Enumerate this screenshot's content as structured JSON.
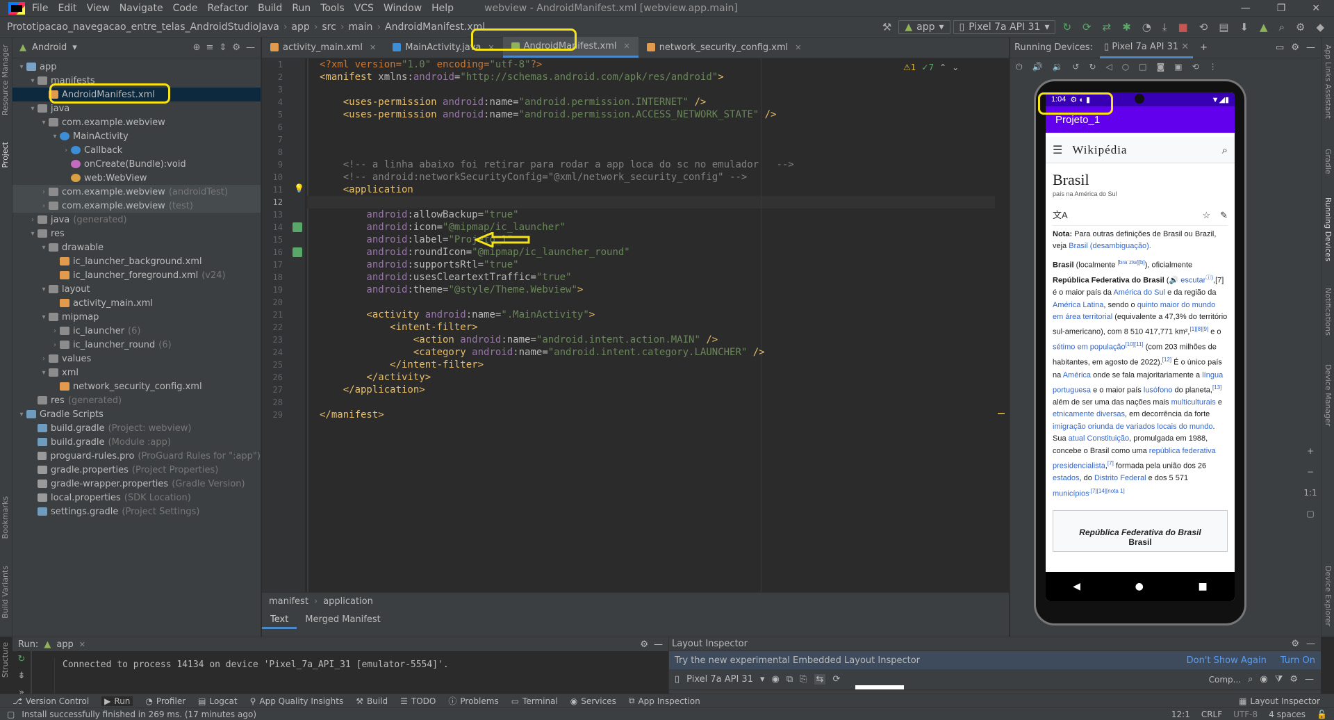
{
  "menu": {
    "items": [
      "File",
      "Edit",
      "View",
      "Navigate",
      "Code",
      "Refactor",
      "Build",
      "Run",
      "Tools",
      "VCS",
      "Window",
      "Help"
    ],
    "window_title": "webview - AndroidManifest.xml [webview.app.main]"
  },
  "nav": {
    "crumbs": [
      "Prototipacao_navegacao_entre_telas_AndroidStudioJava",
      "app",
      "src",
      "main",
      "AndroidManifest.xml"
    ],
    "run_config": "app",
    "device": "Pixel 7a API 31"
  },
  "project": {
    "view_label": "Android",
    "tree": [
      {
        "indent": 0,
        "arrow": "▾",
        "icon": "folderb",
        "label": "app",
        "dim": ""
      },
      {
        "indent": 1,
        "arrow": "▾",
        "icon": "folder",
        "label": "manifests",
        "dim": ""
      },
      {
        "indent": 2,
        "arrow": "",
        "icon": "xml",
        "label": "AndroidManifest.xml",
        "dim": "",
        "sel": true
      },
      {
        "indent": 1,
        "arrow": "▾",
        "icon": "folder",
        "label": "java",
        "dim": ""
      },
      {
        "indent": 2,
        "arrow": "▾",
        "icon": "folder",
        "label": "com.example.webview",
        "dim": ""
      },
      {
        "indent": 3,
        "arrow": "▾",
        "icon": "cls",
        "label": "MainActivity",
        "dim": ""
      },
      {
        "indent": 4,
        "arrow": "›",
        "icon": "cls",
        "label": "Callback",
        "dim": ""
      },
      {
        "indent": 4,
        "arrow": "",
        "icon": "meth",
        "label": "onCreate(Bundle):void",
        "dim": ""
      },
      {
        "indent": 4,
        "arrow": "",
        "icon": "fld",
        "label": "web:WebView",
        "dim": ""
      },
      {
        "indent": 2,
        "arrow": "›",
        "icon": "folder",
        "label": "com.example.webview",
        "dim": "(androidTest)",
        "gray": true
      },
      {
        "indent": 2,
        "arrow": "›",
        "icon": "folder",
        "label": "com.example.webview",
        "dim": "(test)",
        "gray": true
      },
      {
        "indent": 1,
        "arrow": "›",
        "icon": "folder",
        "label": "java",
        "dim": "(generated)"
      },
      {
        "indent": 1,
        "arrow": "▾",
        "icon": "folder",
        "label": "res",
        "dim": ""
      },
      {
        "indent": 2,
        "arrow": "▾",
        "icon": "folder",
        "label": "drawable",
        "dim": ""
      },
      {
        "indent": 3,
        "arrow": "",
        "icon": "xml",
        "label": "ic_launcher_background.xml",
        "dim": ""
      },
      {
        "indent": 3,
        "arrow": "",
        "icon": "xml",
        "label": "ic_launcher_foreground.xml",
        "dim": "(v24)"
      },
      {
        "indent": 2,
        "arrow": "▾",
        "icon": "folder",
        "label": "layout",
        "dim": ""
      },
      {
        "indent": 3,
        "arrow": "",
        "icon": "xml",
        "label": "activity_main.xml",
        "dim": ""
      },
      {
        "indent": 2,
        "arrow": "▾",
        "icon": "folder",
        "label": "mipmap",
        "dim": ""
      },
      {
        "indent": 3,
        "arrow": "›",
        "icon": "folder",
        "label": "ic_launcher",
        "dim": "(6)"
      },
      {
        "indent": 3,
        "arrow": "›",
        "icon": "folder",
        "label": "ic_launcher_round",
        "dim": "(6)"
      },
      {
        "indent": 2,
        "arrow": "›",
        "icon": "folder",
        "label": "values",
        "dim": ""
      },
      {
        "indent": 2,
        "arrow": "▾",
        "icon": "folder",
        "label": "xml",
        "dim": ""
      },
      {
        "indent": 3,
        "arrow": "",
        "icon": "xml",
        "label": "network_security_config.xml",
        "dim": ""
      },
      {
        "indent": 1,
        "arrow": "",
        "icon": "folder",
        "label": "res",
        "dim": "(generated)"
      },
      {
        "indent": 0,
        "arrow": "▾",
        "icon": "grad",
        "label": "Gradle Scripts",
        "dim": ""
      },
      {
        "indent": 1,
        "arrow": "",
        "icon": "grad",
        "label": "build.gradle",
        "dim": "(Project: webview)"
      },
      {
        "indent": 1,
        "arrow": "",
        "icon": "grad",
        "label": "build.gradle",
        "dim": "(Module :app)"
      },
      {
        "indent": 1,
        "arrow": "",
        "icon": "file",
        "label": "proguard-rules.pro",
        "dim": "(ProGuard Rules for \":app\")"
      },
      {
        "indent": 1,
        "arrow": "",
        "icon": "file",
        "label": "gradle.properties",
        "dim": "(Project Properties)"
      },
      {
        "indent": 1,
        "arrow": "",
        "icon": "file",
        "label": "gradle-wrapper.properties",
        "dim": "(Gradle Version)"
      },
      {
        "indent": 1,
        "arrow": "",
        "icon": "file",
        "label": "local.properties",
        "dim": "(SDK Location)"
      },
      {
        "indent": 1,
        "arrow": "",
        "icon": "grad",
        "label": "settings.gradle",
        "dim": "(Project Settings)"
      }
    ]
  },
  "left_strip": [
    "Resource Manager",
    "Project",
    "Bookmarks",
    "Build Variants",
    "Structure"
  ],
  "right_strip": [
    "App Links Assistant",
    "Gradle",
    "Running Devices",
    "Notifications",
    "Device Manager",
    "Device Explorer"
  ],
  "tabs": [
    {
      "label": "activity_main.xml",
      "color": "#e29a4c"
    },
    {
      "label": "MainActivity.java",
      "color": "#3d8ed6"
    },
    {
      "label": "AndroidManifest.xml",
      "color": "#8fb35a",
      "active": true
    },
    {
      "label": "network_security_config.xml",
      "color": "#e29a4c"
    }
  ],
  "inspections": {
    "warn": "⚠1",
    "ok": "✓7"
  },
  "code_lines": [
    [
      [
        "<?xml version=",
        "pl"
      ],
      [
        "\"1.0\"",
        "st"
      ],
      [
        " encoding=",
        "pl"
      ],
      [
        "\"utf-8\"",
        "st"
      ],
      [
        "?>",
        "pl"
      ]
    ],
    [
      [
        "<manifest ",
        "tg"
      ],
      [
        "xmlns:",
        "at"
      ],
      [
        "android",
        "ns"
      ],
      [
        "=",
        "at"
      ],
      [
        "\"http://schemas.android.com/apk/res/android\"",
        "st"
      ],
      [
        ">",
        "tg"
      ]
    ],
    [],
    [
      [
        "    <uses-permission ",
        "tg"
      ],
      [
        "android",
        "ns"
      ],
      [
        ":name=",
        "at"
      ],
      [
        "\"android.permission.INTERNET\"",
        "st"
      ],
      [
        " />",
        "tg"
      ]
    ],
    [
      [
        "    <uses-permission ",
        "tg"
      ],
      [
        "android",
        "ns"
      ],
      [
        ":name=",
        "at"
      ],
      [
        "\"android.permission.ACCESS_NETWORK_STATE\"",
        "st"
      ],
      [
        " />",
        "tg"
      ]
    ],
    [],
    [],
    [],
    [
      [
        "    <!-- a linha abaixo foi retirar para rodar a app loca do sc no emulador   -->",
        "cm"
      ]
    ],
    [
      [
        "    <!-- android:networkSecurityConfig=\"@xml/network_security_config\" -->",
        "cm"
      ]
    ],
    [
      [
        "    <application",
        "tg"
      ]
    ],
    [],
    [
      [
        "        android",
        "ns"
      ],
      [
        ":allowBackup=",
        "at"
      ],
      [
        "\"true\"",
        "st"
      ]
    ],
    [
      [
        "        android",
        "ns"
      ],
      [
        ":icon=",
        "at"
      ],
      [
        "\"@mipmap/ic_launcher\"",
        "st"
      ]
    ],
    [
      [
        "        android",
        "ns"
      ],
      [
        ":label=",
        "at"
      ],
      [
        "\"Projeto_1\"",
        "st"
      ]
    ],
    [
      [
        "        android",
        "ns"
      ],
      [
        ":roundIcon=",
        "at"
      ],
      [
        "\"@mipmap/ic_launcher_round\"",
        "st"
      ]
    ],
    [
      [
        "        android",
        "ns"
      ],
      [
        ":supportsRtl=",
        "at"
      ],
      [
        "\"true\"",
        "st"
      ]
    ],
    [
      [
        "        android",
        "ns"
      ],
      [
        ":usesCleartextTraffic=",
        "at"
      ],
      [
        "\"true\"",
        "st"
      ]
    ],
    [
      [
        "        android",
        "ns"
      ],
      [
        ":theme=",
        "at"
      ],
      [
        "\"@style/Theme.Webview\"",
        "st"
      ],
      [
        ">",
        "tg"
      ]
    ],
    [],
    [
      [
        "        <activity ",
        "tg"
      ],
      [
        "android",
        "ns"
      ],
      [
        ":name=",
        "at"
      ],
      [
        "\".MainActivity\"",
        "st"
      ],
      [
        ">",
        "tg"
      ]
    ],
    [
      [
        "            <intent-filter>",
        "tg"
      ]
    ],
    [
      [
        "                <action ",
        "tg"
      ],
      [
        "android",
        "ns"
      ],
      [
        ":name=",
        "at"
      ],
      [
        "\"android.intent.action.MAIN\"",
        "st"
      ],
      [
        " />",
        "tg"
      ]
    ],
    [
      [
        "                <category ",
        "tg"
      ],
      [
        "android",
        "ns"
      ],
      [
        ":name=",
        "at"
      ],
      [
        "\"android.intent.category.LAUNCHER\"",
        "st"
      ],
      [
        " />",
        "tg"
      ]
    ],
    [
      [
        "            </intent-filter>",
        "tg"
      ]
    ],
    [
      [
        "        </activity>",
        "tg"
      ]
    ],
    [
      [
        "    </application>",
        "tg"
      ]
    ],
    [],
    [
      [
        "</manifest>",
        "tg"
      ]
    ]
  ],
  "editor_footer": {
    "crumbs": [
      "manifest",
      "application"
    ],
    "tabs": [
      "Text",
      "Merged Manifest"
    ]
  },
  "devices": {
    "label": "Running Devices:",
    "device": "Pixel 7a API 31"
  },
  "phone": {
    "time": "1:04",
    "app_title": "Projeto_1",
    "wiki_logo": "Wikipédia",
    "article_title": "Brasil",
    "article_sub": "país na América do Sul",
    "note_bold": "Nota:",
    "note_text": "Para outras definições de Brasil ou Brazil, veja",
    "note_link": "Brasil (desambiguação).",
    "body": [
      [
        [
          "Brasil",
          "b"
        ],
        [
          " (localmente ",
          ""
        ],
        [
          "[bɾaˈziw]",
          "l"
        ],
        [
          "[b]",
          ""
        ],
        [
          "), oficialmente ",
          ""
        ],
        [
          "República Federativa do Brasil",
          "b"
        ],
        [
          " (🔊 ",
          ""
        ],
        [
          "escutar",
          "l"
        ],
        [
          "ⓘ)",
          ""
        ],
        [
          ",[7] é o maior país da ",
          ""
        ],
        [
          "América do Sul",
          "l"
        ],
        [
          " e da região da ",
          ""
        ],
        [
          "América Latina",
          "l"
        ],
        [
          ", sendo o ",
          ""
        ],
        [
          "quinto maior do mundo em área territorial",
          "l"
        ],
        [
          " (equivalente a 47,3% do território sul-americano), com 8 510 417,771 km²,",
          ""
        ],
        [
          "[1][8][9]",
          ""
        ],
        [
          " e o ",
          ""
        ],
        [
          "sétimo em população",
          "l"
        ],
        [
          "[10][11]",
          ""
        ],
        [
          " (com 203 milhões de habitantes, em agosto de 2022).",
          ""
        ],
        [
          "[12]",
          ""
        ],
        [
          " É o único país na ",
          ""
        ],
        [
          "América",
          "l"
        ],
        [
          " onde se fala majoritariamente a ",
          ""
        ],
        [
          "língua portuguesa",
          "l"
        ],
        [
          " e o maior país ",
          ""
        ],
        [
          "lusófono",
          "l"
        ],
        [
          " do planeta,",
          ""
        ],
        [
          "[13]",
          ""
        ],
        [
          " além de ser uma das nações mais ",
          ""
        ],
        [
          "multiculturais",
          "l"
        ],
        [
          " e ",
          ""
        ],
        [
          "etnicamente diversas",
          "l"
        ],
        [
          ", em decorrência da forte ",
          ""
        ],
        [
          "imigração oriunda de variados locais do mundo",
          "l"
        ],
        [
          ". Sua ",
          ""
        ],
        [
          "atual Constituição",
          "l"
        ],
        [
          ", promulgada em 1988, concebe o Brasil como uma ",
          ""
        ],
        [
          "república federativa presidencialista",
          "l"
        ],
        [
          ",",
          ""
        ],
        [
          "[7]",
          ""
        ],
        [
          " formada pela união dos 26 ",
          ""
        ],
        [
          "estados",
          "l"
        ],
        [
          ", do ",
          ""
        ],
        [
          "Distrito Federal",
          "l"
        ],
        [
          " e dos 5 571 ",
          ""
        ],
        [
          "municípios",
          "l"
        ],
        [
          ".[7][14][nota 1]",
          ""
        ]
      ]
    ],
    "infobox_title": "República Federativa do Brasil",
    "infobox_sub": "Brasil"
  },
  "run": {
    "label": "Run:",
    "config": "app",
    "console": "Connected to process 14134 on device 'Pixel_7a_API_31 [emulator-5554]'."
  },
  "layout_inspector": {
    "title": "Layout Inspector",
    "banner": "Try the new experimental Embedded Layout Inspector",
    "dont_show": "Don't Show Again",
    "turn_on": "Turn On",
    "device": "Pixel 7a API 31",
    "comp": "Comp..."
  },
  "bottom_tools": [
    "Version Control",
    "Run",
    "Profiler",
    "Logcat",
    "App Quality Insights",
    "Build",
    "TODO",
    "Problems",
    "Terminal",
    "Services",
    "App Inspection"
  ],
  "bottom_right_tool": "Layout Inspector",
  "status": {
    "message": "Install successfully finished in 269 ms. (17 minutes ago)",
    "pos": "12:1",
    "eol": "CRLF",
    "enc": "UTF-8",
    "indent": "4 spaces"
  },
  "colors": {
    "accent_purple": "#6200ee",
    "status_purple": "#3700b3",
    "highlight": "#f7e31a"
  }
}
